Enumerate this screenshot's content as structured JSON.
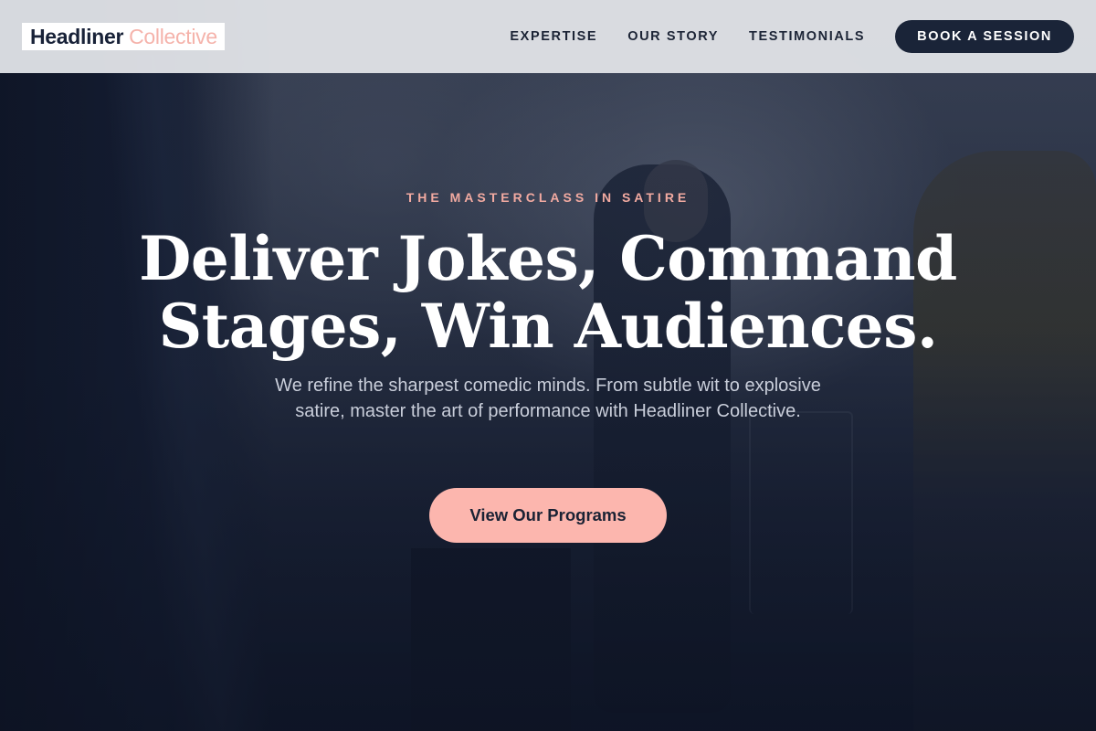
{
  "brand": {
    "name_primary": "Headliner",
    "name_accent": "Collective",
    "accent_color": "#f5b3ab",
    "dark_color": "#1a2438"
  },
  "nav": {
    "links": [
      {
        "label": "EXPERTISE"
      },
      {
        "label": "OUR STORY"
      },
      {
        "label": "TESTIMONIALS"
      }
    ],
    "cta_label": "BOOK A SESSION"
  },
  "hero": {
    "eyebrow": "THE MASTERCLASS IN SATIRE",
    "headline": "Deliver Jokes, Command Stages, Win Audiences.",
    "subcopy": "We refine the sharpest comedic minds. From subtle wit to explosive satire, master the art of performance with Headliner Collective.",
    "cta_label": "View Our Programs",
    "background_image": "comedian performing on stage with photographer"
  }
}
